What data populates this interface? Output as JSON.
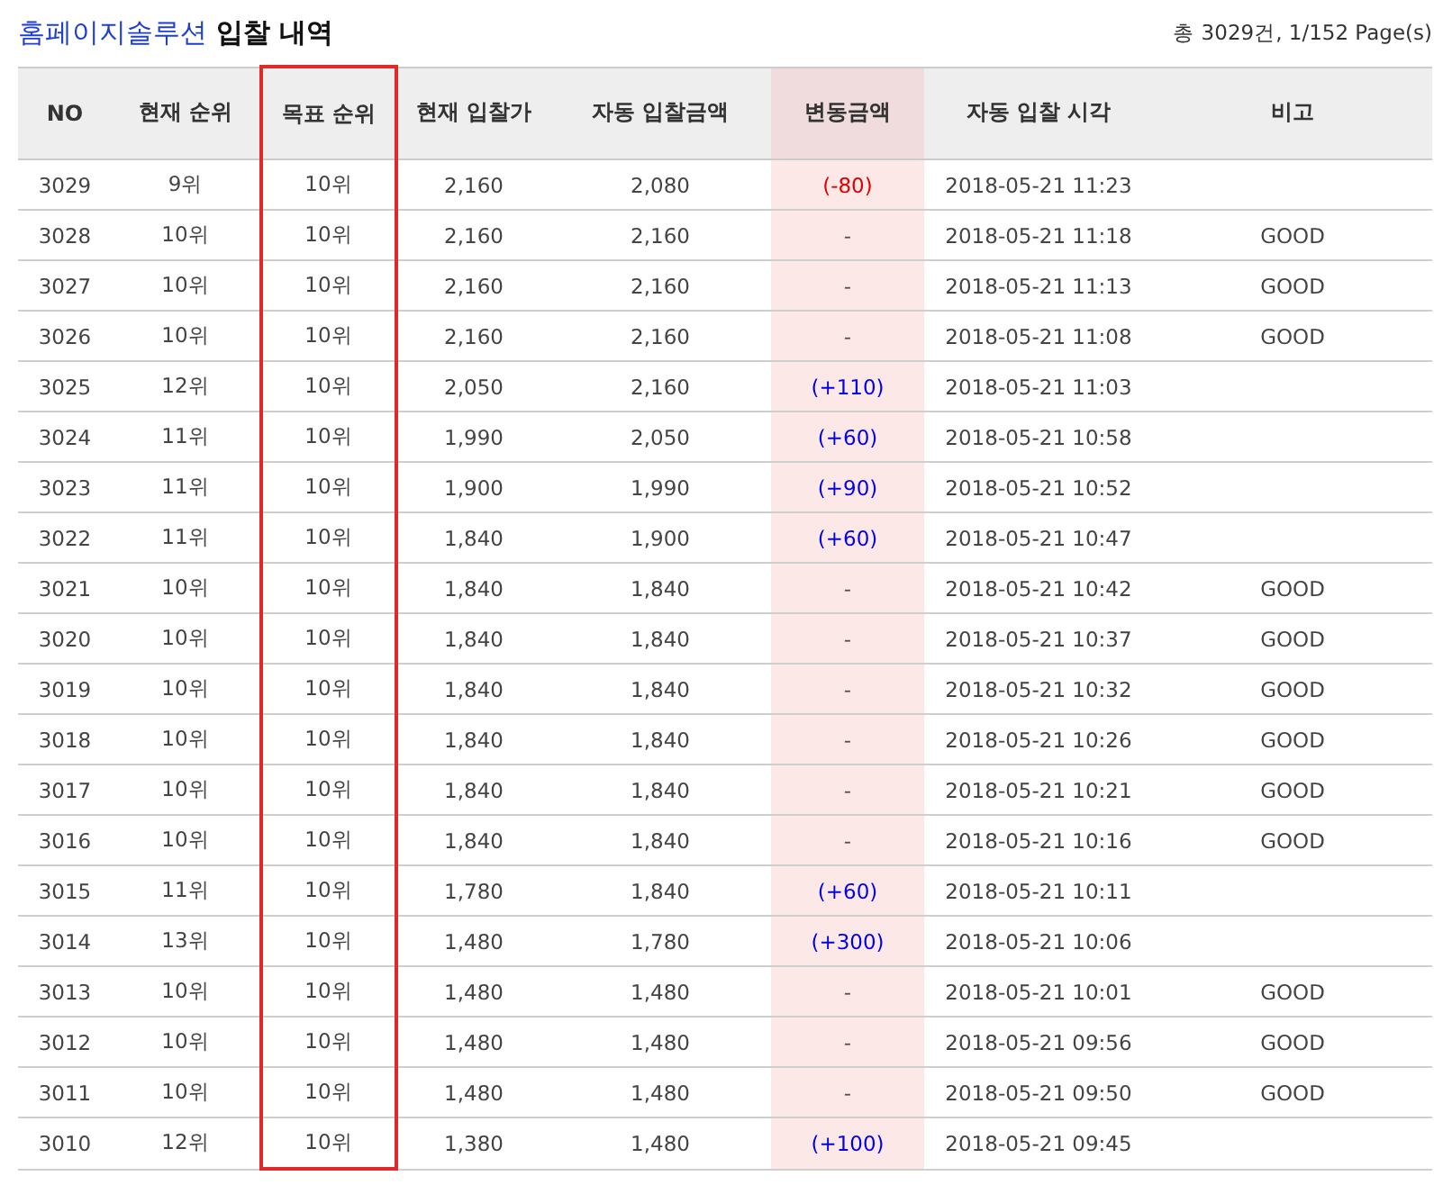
{
  "title": {
    "brand": "홈페이지솔루션",
    "text": "입찰 내역"
  },
  "summary": "총 3029건, 1/152 Page(s)",
  "columns": [
    {
      "label": "NO",
      "kind": "plain"
    },
    {
      "label": "현재 순위",
      "kind": "plain"
    },
    {
      "label": "목표 순위",
      "kind": "outlined"
    },
    {
      "label": "현재 입찰가",
      "kind": "plain"
    },
    {
      "label": "자동 입찰금액",
      "kind": "plain"
    },
    {
      "label": "변동금액",
      "kind": "shaded"
    },
    {
      "label": "자동 입찰 시각",
      "kind": "plain"
    },
    {
      "label": "비고",
      "kind": "plain"
    }
  ],
  "rows": [
    {
      "cells": [
        "3029",
        "9위",
        "10위",
        "2,160",
        "2,080",
        "(-80)",
        "2018-05-21 11:23",
        ""
      ],
      "color": "#e00000"
    },
    {
      "cells": [
        "3028",
        "10위",
        "10위",
        "2,160",
        "2,160",
        "-",
        "2018-05-21 11:18",
        "GOOD"
      ],
      "color": "#555555"
    },
    {
      "cells": [
        "3027",
        "10위",
        "10위",
        "2,160",
        "2,160",
        "-",
        "2018-05-21 11:13",
        "GOOD"
      ],
      "color": "#555555"
    },
    {
      "cells": [
        "3026",
        "10위",
        "10위",
        "2,160",
        "2,160",
        "-",
        "2018-05-21 11:08",
        "GOOD"
      ],
      "color": "#555555"
    },
    {
      "cells": [
        "3025",
        "12위",
        "10위",
        "2,050",
        "2,160",
        "(+110)",
        "2018-05-21 11:03",
        ""
      ],
      "color": "#0000ee"
    },
    {
      "cells": [
        "3024",
        "11위",
        "10위",
        "1,990",
        "2,050",
        "(+60)",
        "2018-05-21 10:58",
        ""
      ],
      "color": "#0000ee"
    },
    {
      "cells": [
        "3023",
        "11위",
        "10위",
        "1,900",
        "1,990",
        "(+90)",
        "2018-05-21 10:52",
        ""
      ],
      "color": "#0000ee"
    },
    {
      "cells": [
        "3022",
        "11위",
        "10위",
        "1,840",
        "1,900",
        "(+60)",
        "2018-05-21 10:47",
        ""
      ],
      "color": "#0000ee"
    },
    {
      "cells": [
        "3021",
        "10위",
        "10위",
        "1,840",
        "1,840",
        "-",
        "2018-05-21 10:42",
        "GOOD"
      ],
      "color": "#555555"
    },
    {
      "cells": [
        "3020",
        "10위",
        "10위",
        "1,840",
        "1,840",
        "-",
        "2018-05-21 10:37",
        "GOOD"
      ],
      "color": "#555555"
    },
    {
      "cells": [
        "3019",
        "10위",
        "10위",
        "1,840",
        "1,840",
        "-",
        "2018-05-21 10:32",
        "GOOD"
      ],
      "color": "#555555"
    },
    {
      "cells": [
        "3018",
        "10위",
        "10위",
        "1,840",
        "1,840",
        "-",
        "2018-05-21 10:26",
        "GOOD"
      ],
      "color": "#555555"
    },
    {
      "cells": [
        "3017",
        "10위",
        "10위",
        "1,840",
        "1,840",
        "-",
        "2018-05-21 10:21",
        "GOOD"
      ],
      "color": "#555555"
    },
    {
      "cells": [
        "3016",
        "10위",
        "10위",
        "1,840",
        "1,840",
        "-",
        "2018-05-21 10:16",
        "GOOD"
      ],
      "color": "#555555"
    },
    {
      "cells": [
        "3015",
        "11위",
        "10위",
        "1,780",
        "1,840",
        "(+60)",
        "2018-05-21 10:11",
        ""
      ],
      "color": "#0000ee"
    },
    {
      "cells": [
        "3014",
        "13위",
        "10위",
        "1,480",
        "1,780",
        "(+300)",
        "2018-05-21 10:06",
        ""
      ],
      "color": "#0000ee"
    },
    {
      "cells": [
        "3013",
        "10위",
        "10위",
        "1,480",
        "1,480",
        "-",
        "2018-05-21 10:01",
        "GOOD"
      ],
      "color": "#555555"
    },
    {
      "cells": [
        "3012",
        "10위",
        "10위",
        "1,480",
        "1,480",
        "-",
        "2018-05-21 09:56",
        "GOOD"
      ],
      "color": "#555555"
    },
    {
      "cells": [
        "3011",
        "10위",
        "10위",
        "1,480",
        "1,480",
        "-",
        "2018-05-21 09:50",
        "GOOD"
      ],
      "color": "#555555"
    },
    {
      "cells": [
        "3010",
        "12위",
        "10위",
        "1,380",
        "1,480",
        "(+100)",
        "2018-05-21 09:45",
        ""
      ],
      "color": "#0000ee"
    }
  ]
}
